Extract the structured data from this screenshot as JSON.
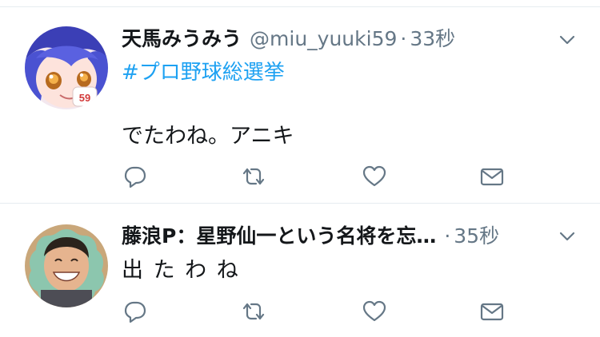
{
  "tweets": [
    {
      "display_name": "天馬みうみう",
      "handle": "@miu_yuuki59",
      "separator": "·",
      "time": "33秒",
      "hashtag": "#プロ野球総選挙",
      "text": "でたわね。アニキ",
      "avatar_number": "59",
      "icons": [
        "reply-icon",
        "retweet-icon",
        "like-icon",
        "direct-message-icon",
        "chevron-down-icon"
      ]
    },
    {
      "display_name": "藤浪P：星野仙一という名将を忘…",
      "separator": "·",
      "time": "35秒",
      "text": "出 た わ ね",
      "icons": [
        "reply-icon",
        "retweet-icon",
        "like-icon",
        "direct-message-icon",
        "chevron-down-icon"
      ]
    }
  ],
  "colors": {
    "link": "#1da1f2",
    "secondary_text": "#657786",
    "icon": "#657786",
    "divider": "#e6ecf0"
  }
}
